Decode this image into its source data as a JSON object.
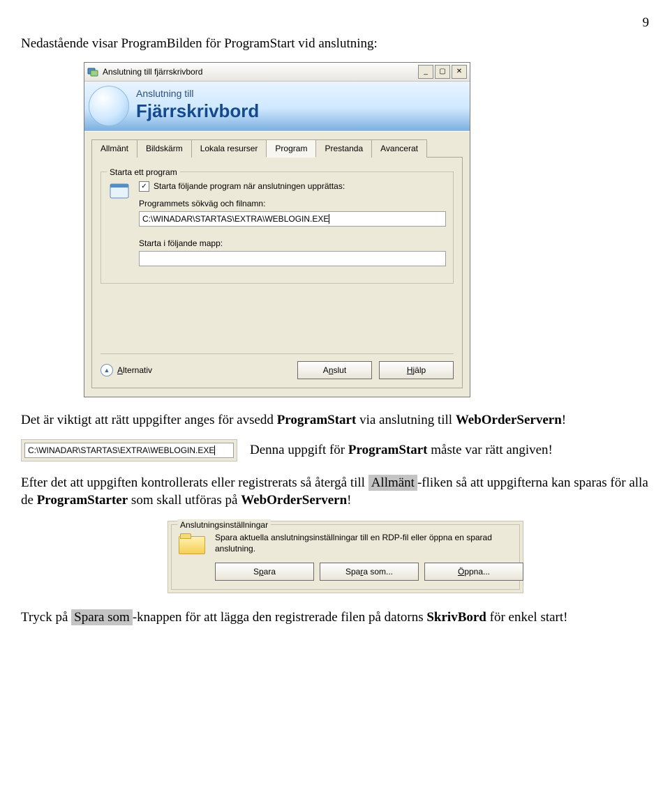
{
  "page_number": "9",
  "intro": "Nedastående visar ProgramBilden för ProgramStart vid anslutning:",
  "dialog": {
    "title": "Anslutning till fjärrskrivbord",
    "banner_small": "Anslutning till",
    "banner_large": "Fjärrskrivbord",
    "tabs": [
      "Allmänt",
      "Bildskärm",
      "Lokala resurser",
      "Program",
      "Prestanda",
      "Avancerat"
    ],
    "active_tab_index": 3,
    "group_legend": "Starta ett program",
    "checkbox_checked": true,
    "checkbox_label": "Starta följande program när anslutningen upprättas:",
    "path_label": "Programmets sökväg och filnamn:",
    "path_value": "C:\\WINADAR\\STARTAS\\EXTRA\\WEBLOGIN.EXE",
    "folder_label": "Starta i följande mapp:",
    "folder_value": "",
    "alternativ": "Alternativ",
    "anslut": "Anslut",
    "hjalp": "Hjälp"
  },
  "aftertext": {
    "line1a": "Det är viktigt att rätt uppgifter anges för avsedd ",
    "line1b": "ProgramStart",
    "line1c": " via anslutning till ",
    "line1d": "WebOrderServern",
    "line1e": "!"
  },
  "inline": {
    "path_value": "C:\\WINADAR\\STARTAS\\EXTRA\\WEBLOGIN.EXE",
    "text_a": "Denna uppgift för ",
    "text_b": "ProgramStart",
    "text_c": " måste var rätt angiven!"
  },
  "para2": {
    "a": "Efter det att uppgiften kontrollerats eller registrerats så återgå till ",
    "b": "Allmänt",
    "c": "-fliken så att uppgifterna kan sparas för alla de ",
    "d": "ProgramStarter",
    "e": " som skall utföras på ",
    "f": "WebOrderServern",
    "g": "!"
  },
  "settings": {
    "legend": "Anslutningsinställningar",
    "text": "Spara aktuella anslutningsinställningar till en RDP-fil eller öppna en sparad anslutning.",
    "spara": "Spara",
    "spara_som": "Spara som...",
    "oppna": "Öppna..."
  },
  "final": {
    "a": "Tryck på ",
    "b": "Spara som",
    "c": "-knappen för att lägga den registrerade filen på datorns ",
    "d": "SkrivBord",
    "e": " för enkel start!"
  }
}
